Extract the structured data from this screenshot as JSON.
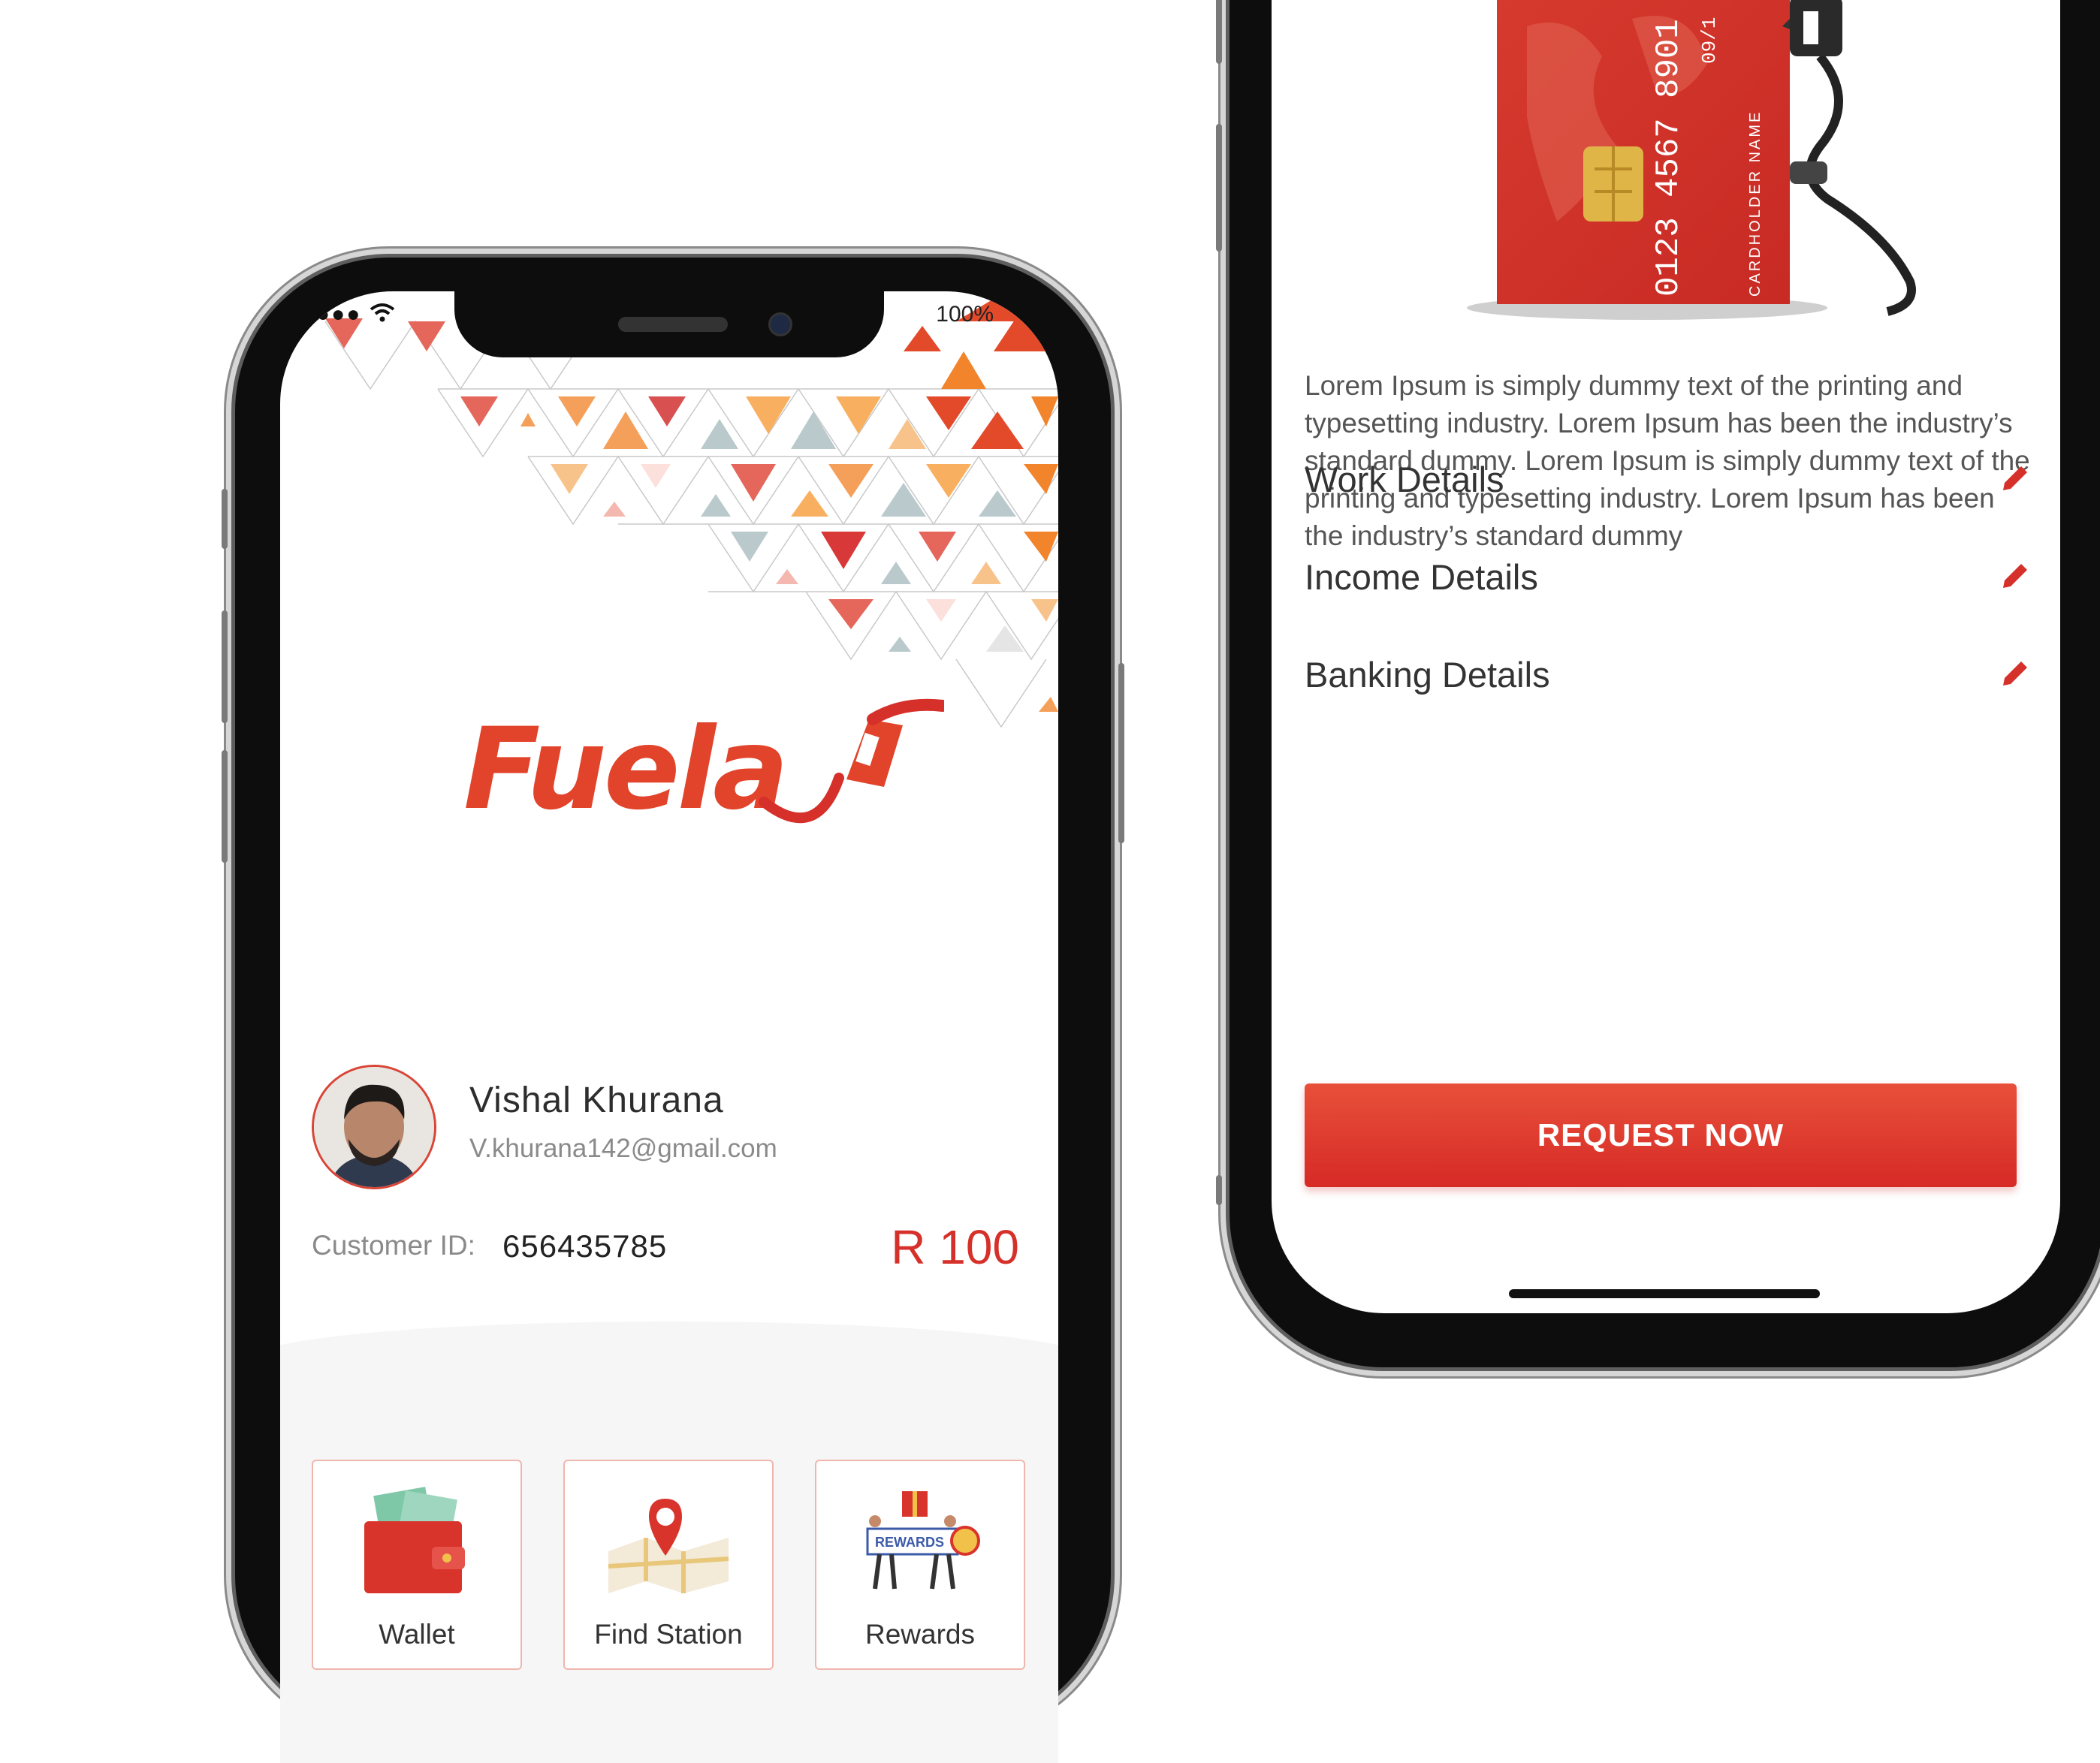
{
  "status_bar": {
    "signal": "●●●",
    "wifi": "wifi-icon",
    "battery": "100%"
  },
  "brand": {
    "name": "Fuela",
    "accent": "#e2432b",
    "primary_red": "#d6302a"
  },
  "profile": {
    "name": "Vishal Khurana",
    "email": "V.khurana142@gmail.com",
    "customer_id_label": "Customer ID:",
    "customer_id": "656435785",
    "balance": "R 100"
  },
  "menu": [
    {
      "label": "Wallet",
      "icon": "wallet-icon"
    },
    {
      "label": "Find Station",
      "icon": "map-pin-icon"
    },
    {
      "label": "Rewards",
      "icon": "rewards-icon"
    }
  ],
  "detail_screen": {
    "description": "Lorem Ipsum is simply dummy text of the printing and typesetting industry. Lorem Ipsum has been the industry’s standard dummy. Lorem Ipsum is simply dummy text of the printing and typesetting industry. Lorem Ipsum has been the industry’s standard dummy",
    "rows": [
      {
        "label": "Work Details",
        "icon": "pencil-icon"
      },
      {
        "label": "Income Details",
        "icon": "pencil-icon"
      },
      {
        "label": "Banking Details",
        "icon": "pencil-icon"
      }
    ],
    "button": "REQUEST NOW"
  },
  "card": {
    "number": "0123 4567 8901",
    "holder": "CARDHOLDER NAME",
    "expiry": "09/1"
  }
}
